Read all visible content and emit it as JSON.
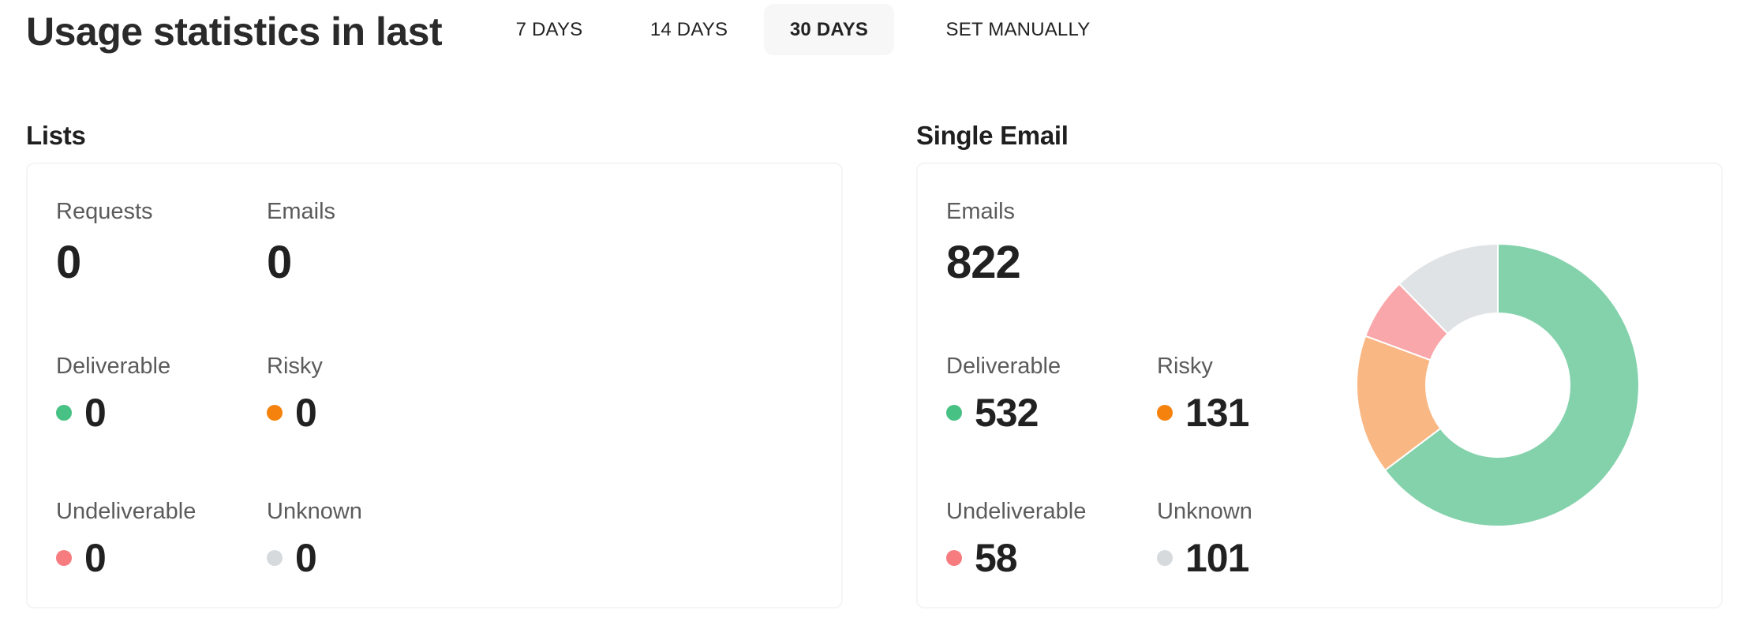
{
  "header": {
    "title": "Usage statistics in last",
    "tabs": [
      {
        "label": "7 DAYS",
        "active": false
      },
      {
        "label": "14 DAYS",
        "active": false
      },
      {
        "label": "30 DAYS",
        "active": true
      },
      {
        "label": "SET MANUALLY",
        "active": false
      }
    ]
  },
  "colors": {
    "deliverable_dot": "#48c184",
    "risky_dot": "#f5820d",
    "undeliverable_dot": "#f77c80",
    "unknown_dot": "#d6dadd",
    "deliverable_slice": "#84d2ac",
    "risky_slice": "#f9b784",
    "undeliverable_slice": "#f9a7aa",
    "unknown_slice": "#e0e3e6"
  },
  "lists": {
    "title": "Lists",
    "requests_label": "Requests",
    "requests_value": "0",
    "emails_label": "Emails",
    "emails_value": "0",
    "deliverable_label": "Deliverable",
    "deliverable_value": "0",
    "risky_label": "Risky",
    "risky_value": "0",
    "undeliverable_label": "Undeliverable",
    "undeliverable_value": "0",
    "unknown_label": "Unknown",
    "unknown_value": "0"
  },
  "single_email": {
    "title": "Single Email",
    "emails_label": "Emails",
    "emails_value": "822",
    "deliverable_label": "Deliverable",
    "deliverable_value": "532",
    "risky_label": "Risky",
    "risky_value": "131",
    "undeliverable_label": "Undeliverable",
    "undeliverable_value": "58",
    "unknown_label": "Unknown",
    "unknown_value": "101"
  },
  "chart_data": {
    "type": "pie",
    "variant": "donut",
    "title": "",
    "categories": [
      "Deliverable",
      "Risky",
      "Undeliverable",
      "Unknown"
    ],
    "values": [
      532,
      131,
      58,
      101
    ],
    "colors": [
      "#84d2ac",
      "#f9b784",
      "#f9a7aa",
      "#e0e3e6"
    ],
    "start": "top",
    "direction": "clockwise",
    "legend": "none"
  }
}
